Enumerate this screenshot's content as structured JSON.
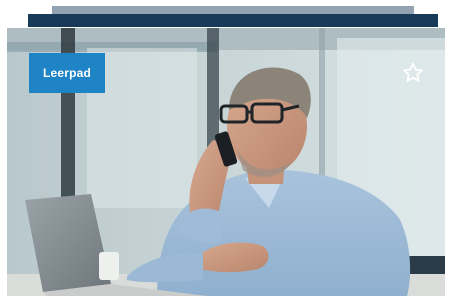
{
  "card": {
    "badge_label": "Leerpad",
    "favorite_icon": "star-outline-icon",
    "image_subject": "man-on-phone-at-laptop",
    "colors": {
      "badge_bg": "#1f84c6",
      "stack_back": "#93a2b1",
      "stack_mid": "#163a57"
    }
  }
}
